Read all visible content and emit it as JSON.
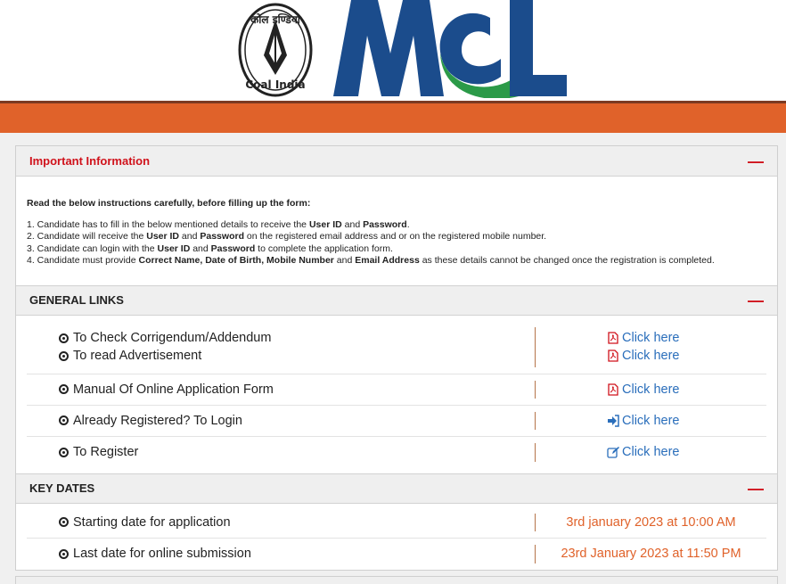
{
  "logos": {
    "coal_india_top": "कोल इण्डिया",
    "coal_india_bottom": "Coal India",
    "mcl": "MCL"
  },
  "important": {
    "title": "Important Information",
    "lead": "Read the below instructions carefully, before filling up the form:",
    "items": [
      [
        "1. Candidate has to fill in the below mentioned details to receive the ",
        "User ID",
        " and ",
        "Password",
        "."
      ],
      [
        "2. Candidate will receive the ",
        "User ID",
        " and ",
        "Password",
        " on the registered email address and or on the registered mobile number."
      ],
      [
        "3. Candidate can login with the ",
        "User ID",
        " and ",
        "Password",
        " to complete the application form."
      ],
      [
        "4. Candidate must provide ",
        "Correct Name, Date of Birth, Mobile Number",
        " and ",
        "Email Address",
        " as these details cannot be changed once the registration is completed."
      ]
    ]
  },
  "general_links": {
    "title": "GENERAL LINKS",
    "rows": [
      {
        "items": [
          "To Check Corrigendum/Addendum",
          "To read Advertisement"
        ],
        "links": [
          {
            "icon": "pdf-icon",
            "label": "Click here"
          },
          {
            "icon": "pdf-icon",
            "label": "Click here"
          }
        ]
      },
      {
        "items": [
          "Manual Of Online Application Form"
        ],
        "links": [
          {
            "icon": "pdf-icon",
            "label": "Click here"
          }
        ]
      },
      {
        "items": [
          "Already Registered? To Login"
        ],
        "links": [
          {
            "icon": "sign-in-icon",
            "label": "Click here"
          }
        ]
      },
      {
        "items": [
          "To Register"
        ],
        "links": [
          {
            "icon": "edit-icon",
            "label": "Click here"
          }
        ]
      }
    ]
  },
  "key_dates": {
    "title": "KEY DATES",
    "rows": [
      {
        "label": "Starting date for application",
        "value": "3rd january 2023 at 10:00 AM"
      },
      {
        "label": "Last date for online submission",
        "value": "23rd January 2023 at 11:50 PM"
      }
    ]
  },
  "colors": {
    "orange": "#e0622a",
    "red": "#d0121b",
    "link_blue": "#2a6ebb",
    "mcl_blue": "#1b4c8c",
    "mcl_green": "#2b9a48"
  }
}
